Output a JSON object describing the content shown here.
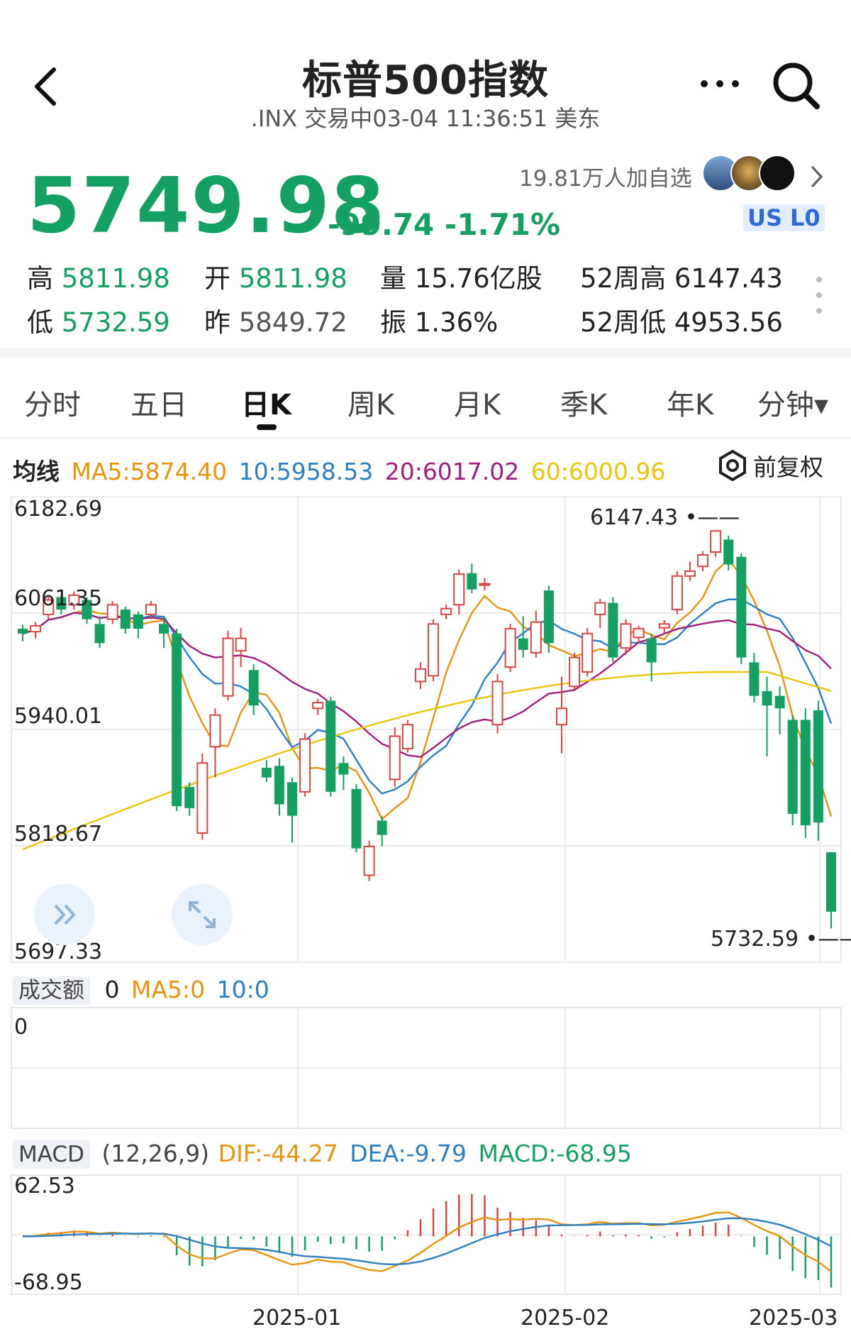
{
  "header": {
    "title": "标普500指数",
    "subtitle": ".INX 交易中03-04 11:36:51 美东"
  },
  "quote": {
    "price": "5749.98",
    "change": "-99.74 -1.71%",
    "followers": "19.81万人加自选",
    "badges": [
      "US",
      "L0"
    ]
  },
  "stats": {
    "high_label": "高",
    "high": "5811.98",
    "low_label": "低",
    "low": "5732.59",
    "open_label": "开",
    "open": "5811.98",
    "prev_label": "昨",
    "prev": "5849.72",
    "vol_label": "量",
    "vol": "15.76亿股",
    "amp_label": "振",
    "amp": "1.36%",
    "w52h_label": "52周高",
    "w52h": "6147.43",
    "w52l_label": "52周低",
    "w52l": "4953.56"
  },
  "tabs": [
    "分时",
    "五日",
    "日K",
    "周K",
    "月K",
    "季K",
    "年K",
    "分钟▾"
  ],
  "ma_bar": {
    "label": "均线",
    "ma5": "MA5:5874.40",
    "ma10": "10:5958.53",
    "ma20": "20:6017.02",
    "ma60": "60:6000.96",
    "adjust": "前复权"
  },
  "colors": {
    "up": "#d84545",
    "down": "#13a062",
    "ma5": "#e8940c",
    "ma10": "#2d7fc3",
    "ma20": "#a01f7c",
    "ma60": "#e9c60c"
  },
  "volume_panel": {
    "label": "成交额",
    "value": "0",
    "ma5": "MA5:0",
    "ma10": "10:0",
    "axis_top": "0"
  },
  "macd_panel": {
    "label": "MACD",
    "params": "(12,26,9)",
    "dif": "DIF:-44.27",
    "dea": "DEA:-9.79",
    "macd": "MACD:-68.95",
    "axis_top": "62.53",
    "axis_bottom": "-68.95"
  },
  "chart_data": {
    "type": "candlestick",
    "y_ticks": [
      "6182.69",
      "6061.35",
      "5940.01",
      "5818.67",
      "5697.33"
    ],
    "ylim": [
      5697.33,
      6182.69
    ],
    "x_ticks": [
      "2025-01",
      "2025-02",
      "2025-03"
    ],
    "annotations": {
      "high": "6147.43",
      "low": "5732.59"
    },
    "candles": [
      {
        "o": 6045,
        "c": 6040,
        "h": 6049,
        "l": 6032
      },
      {
        "o": 6042,
        "c": 6048,
        "h": 6052,
        "l": 6035
      },
      {
        "o": 6060,
        "c": 6075,
        "h": 6078,
        "l": 6055
      },
      {
        "o": 6078,
        "c": 6065,
        "h": 6080,
        "l": 6060
      },
      {
        "o": 6070,
        "c": 6080,
        "h": 6084,
        "l": 6065
      },
      {
        "o": 6075,
        "c": 6055,
        "h": 6078,
        "l": 6050
      },
      {
        "o": 6050,
        "c": 6030,
        "h": 6058,
        "l": 6025
      },
      {
        "o": 6055,
        "c": 6070,
        "h": 6074,
        "l": 6050
      },
      {
        "o": 6065,
        "c": 6045,
        "h": 6068,
        "l": 6040
      },
      {
        "o": 6060,
        "c": 6045,
        "h": 6063,
        "l": 6035
      },
      {
        "o": 6060,
        "c": 6070,
        "h": 6074,
        "l": 6055
      },
      {
        "o": 6050,
        "c": 6040,
        "h": 6058,
        "l": 6025
      },
      {
        "o": 6040,
        "c": 5860,
        "h": 6045,
        "l": 5855
      },
      {
        "o": 5880,
        "c": 5858,
        "h": 5885,
        "l": 5850
      },
      {
        "o": 5832,
        "c": 5905,
        "h": 5915,
        "l": 5825
      },
      {
        "o": 5922,
        "c": 5955,
        "h": 5962,
        "l": 5890
      },
      {
        "o": 5975,
        "c": 6035,
        "h": 6043,
        "l": 5970
      },
      {
        "o": 6022,
        "c": 6035,
        "h": 6046,
        "l": 6005
      },
      {
        "o": 6002,
        "c": 5965,
        "h": 6008,
        "l": 5955
      },
      {
        "o": 5900,
        "c": 5890,
        "h": 5908,
        "l": 5885
      },
      {
        "o": 5902,
        "c": 5862,
        "h": 5910,
        "l": 5850
      },
      {
        "o": 5885,
        "c": 5850,
        "h": 5890,
        "l": 5822
      },
      {
        "o": 5875,
        "c": 5930,
        "h": 5936,
        "l": 5870
      },
      {
        "o": 5962,
        "c": 5968,
        "h": 5972,
        "l": 5955
      },
      {
        "o": 5970,
        "c": 5875,
        "h": 5974,
        "l": 5870
      },
      {
        "o": 5905,
        "c": 5893,
        "h": 5912,
        "l": 5877
      },
      {
        "o": 5878,
        "c": 5816,
        "h": 5883,
        "l": 5812
      },
      {
        "o": 5788,
        "c": 5818,
        "h": 5824,
        "l": 5782
      },
      {
        "o": 5845,
        "c": 5830,
        "h": 5850,
        "l": 5818
      },
      {
        "o": 5888,
        "c": 5933,
        "h": 5942,
        "l": 5880
      },
      {
        "o": 5920,
        "c": 5945,
        "h": 5950,
        "l": 5916
      },
      {
        "o": 5990,
        "c": 6003,
        "h": 6010,
        "l": 5982
      },
      {
        "o": 5996,
        "c": 6050,
        "h": 6055,
        "l": 5990
      },
      {
        "o": 6060,
        "c": 6066,
        "h": 6070,
        "l": 6055
      },
      {
        "o": 6070,
        "c": 6102,
        "h": 6107,
        "l": 6060
      },
      {
        "o": 6103,
        "c": 6086,
        "h": 6113,
        "l": 6082
      },
      {
        "o": 6092,
        "c": 6092,
        "h": 6098,
        "l": 6085
      },
      {
        "o": 5945,
        "c": 5990,
        "h": 5998,
        "l": 5936
      },
      {
        "o": 6005,
        "c": 6045,
        "h": 6050,
        "l": 6000
      },
      {
        "o": 6035,
        "c": 6023,
        "h": 6058,
        "l": 6015
      },
      {
        "o": 6020,
        "c": 6052,
        "h": 6064,
        "l": 6015
      },
      {
        "o": 6085,
        "c": 6030,
        "h": 6090,
        "l": 6020
      },
      {
        "o": 5945,
        "c": 5962,
        "h": 5995,
        "l": 5915
      },
      {
        "o": 5985,
        "c": 6015,
        "h": 6020,
        "l": 5980
      },
      {
        "o": 6000,
        "c": 6040,
        "h": 6046,
        "l": 5995
      },
      {
        "o": 6060,
        "c": 6072,
        "h": 6076,
        "l": 6046
      },
      {
        "o": 6072,
        "c": 6015,
        "h": 6078,
        "l": 6010
      },
      {
        "o": 6025,
        "c": 6050,
        "h": 6055,
        "l": 6018
      },
      {
        "o": 6036,
        "c": 6045,
        "h": 6048,
        "l": 6030
      },
      {
        "o": 6035,
        "c": 6010,
        "h": 6040,
        "l": 5990
      },
      {
        "o": 6046,
        "c": 6050,
        "h": 6054,
        "l": 6040
      },
      {
        "o": 6065,
        "c": 6100,
        "h": 6105,
        "l": 6060
      },
      {
        "o": 6100,
        "c": 6105,
        "h": 6115,
        "l": 6095
      },
      {
        "o": 6110,
        "c": 6122,
        "h": 6126,
        "l": 6105
      },
      {
        "o": 6125,
        "c": 6147,
        "h": 6147.43,
        "l": 6120
      },
      {
        "o": 6138,
        "c": 6112,
        "h": 6142,
        "l": 6106
      },
      {
        "o": 6120,
        "c": 6015,
        "h": 6124,
        "l": 6008
      },
      {
        "o": 6010,
        "c": 5975,
        "h": 6020,
        "l": 5968
      },
      {
        "o": 5980,
        "c": 5965,
        "h": 5995,
        "l": 5912
      },
      {
        "o": 5975,
        "c": 5962,
        "h": 5985,
        "l": 5935
      },
      {
        "o": 5950,
        "c": 5852,
        "h": 5955,
        "l": 5840
      },
      {
        "o": 5950,
        "c": 5840,
        "h": 5962,
        "l": 5827
      },
      {
        "o": 5960,
        "c": 5843,
        "h": 5970,
        "l": 5824
      },
      {
        "o": 5811.98,
        "c": 5749.98,
        "h": 5811.98,
        "l": 5732.59
      }
    ]
  }
}
